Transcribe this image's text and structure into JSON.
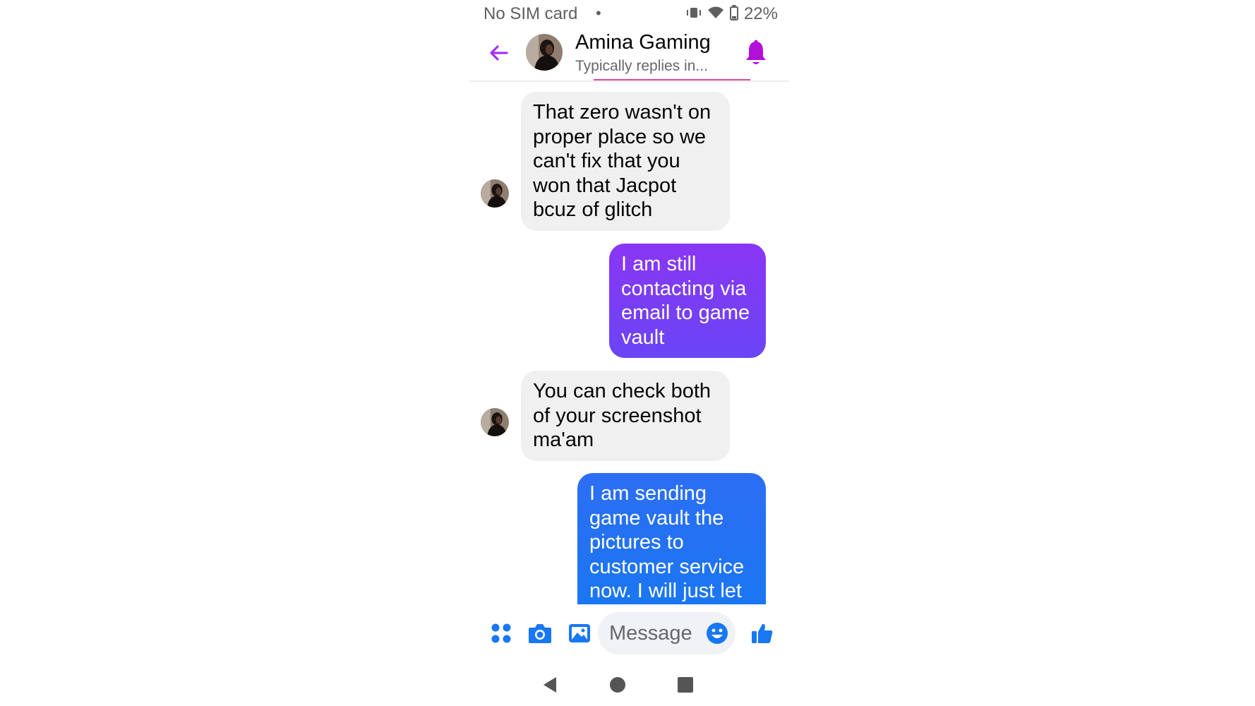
{
  "status_bar": {
    "carrier": "No SIM card",
    "separator": "•",
    "battery": "22%"
  },
  "header": {
    "contact_name": "Amina Gaming",
    "subtitle": "Typically replies in..."
  },
  "messages": [
    {
      "direction": "incoming",
      "text": "That zero wasn't on proper place so we can't fix that you won that Jacpot bcuz of glitch"
    },
    {
      "direction": "outgoing",
      "text": "I am still contacting via email to game vault"
    },
    {
      "direction": "incoming",
      "text": "You can check both of your screenshot ma'am"
    },
    {
      "direction": "outgoing",
      "text": "I am sending game vault the pictures to customer service now. I will just let"
    }
  ],
  "composer": {
    "placeholder": "Message"
  },
  "icons": {
    "back": "back-arrow-icon",
    "bell": "bell-icon",
    "apps": "apps-grid-icon",
    "camera": "camera-icon",
    "gallery": "gallery-icon",
    "emoji": "emoji-icon",
    "like": "thumbs-up-icon",
    "vibrate": "vibrate-icon",
    "wifi": "wifi-icon",
    "battery": "battery-icon",
    "nav_back": "nav-back-icon",
    "nav_home": "nav-home-icon",
    "nav_recents": "nav-recents-icon"
  },
  "colors": {
    "accent_purple": "#a033ff",
    "bell": "#b30fd8",
    "outgoing_purple": "#7b3cf5",
    "outgoing_indigo": "#5b4bf5",
    "outgoing_blue": "#1877f2",
    "incoming_bubble": "#f0f0f0",
    "composer_icon_blue": "#1877f2"
  }
}
